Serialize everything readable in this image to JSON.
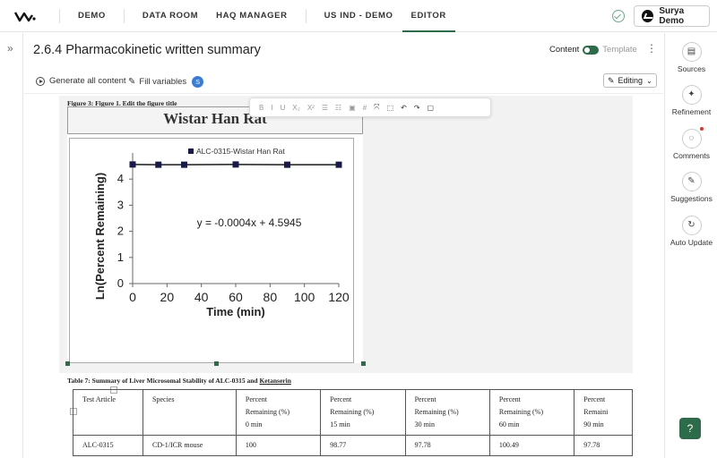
{
  "topnav": {
    "items": [
      "DEMO",
      "DATA ROOM",
      "HAQ MANAGER",
      "US IND - DEMO",
      "EDITOR"
    ],
    "active": "EDITOR",
    "user_name": "Surya Demo"
  },
  "header": {
    "title": "2.6.4 Pharmacokinetic written summary",
    "toggle_on_label": "Content",
    "toggle_off_label": "Template"
  },
  "toolbar": {
    "generate_label": "Generate all content",
    "fill_label": "Fill variables",
    "badge": "S",
    "mode": "Editing"
  },
  "floating_toolbar": {
    "items": [
      "B",
      "I",
      "U",
      "X₂",
      "X²",
      "☰",
      "☷",
      "▣",
      "#",
      "⤧",
      "⬚",
      "↶",
      "↷",
      "▢"
    ]
  },
  "figure": {
    "caption": "Figure 3:  Figure 1. Edit the figure title",
    "frame_title": "Wistar Han Rat"
  },
  "chart_data": {
    "type": "line",
    "xlabel": "Time (min)",
    "ylabel": "Ln(Percent Remaining)",
    "xticks": [
      0,
      20,
      40,
      60,
      80,
      100,
      120
    ],
    "yticks": [
      0,
      1,
      2,
      3,
      4
    ],
    "xlim": [
      0,
      120
    ],
    "ylim": [
      0,
      5
    ],
    "series": [
      {
        "name": "ALC-0315-Wistar Han Rat",
        "x": [
          0,
          15,
          30,
          60,
          90,
          120
        ],
        "y": [
          4.56,
          4.55,
          4.55,
          4.56,
          4.55,
          4.55
        ]
      }
    ],
    "annotation": "y = -0.0004x + 4.5945",
    "legend": "top",
    "grid": false
  },
  "table": {
    "caption_prefix": "Table 7:  Summary of Liver Microsomal Stability of ALC-0315 and ",
    "caption_underlined": "Ketanserin",
    "headers": [
      [
        "Test Article"
      ],
      [
        "Species"
      ],
      [
        "Percent",
        "Remaining (%)",
        "0 min"
      ],
      [
        "Percent",
        "Remaining (%)",
        "15 min"
      ],
      [
        "Percent",
        "Remaining (%)",
        "30 min"
      ],
      [
        "Percent",
        "Remaining (%)",
        "60 min"
      ],
      [
        "Percent",
        "Remaini",
        "90 min"
      ]
    ],
    "rows": [
      [
        "ALC-0315",
        "CD-1/ICR mouse",
        "100",
        "98.77",
        "97.78",
        "100.49",
        "97.78"
      ]
    ]
  },
  "rightrail": {
    "items": [
      "Sources",
      "Refinement",
      "Comments",
      "Suggestions",
      "Auto Update"
    ]
  },
  "help": "?"
}
